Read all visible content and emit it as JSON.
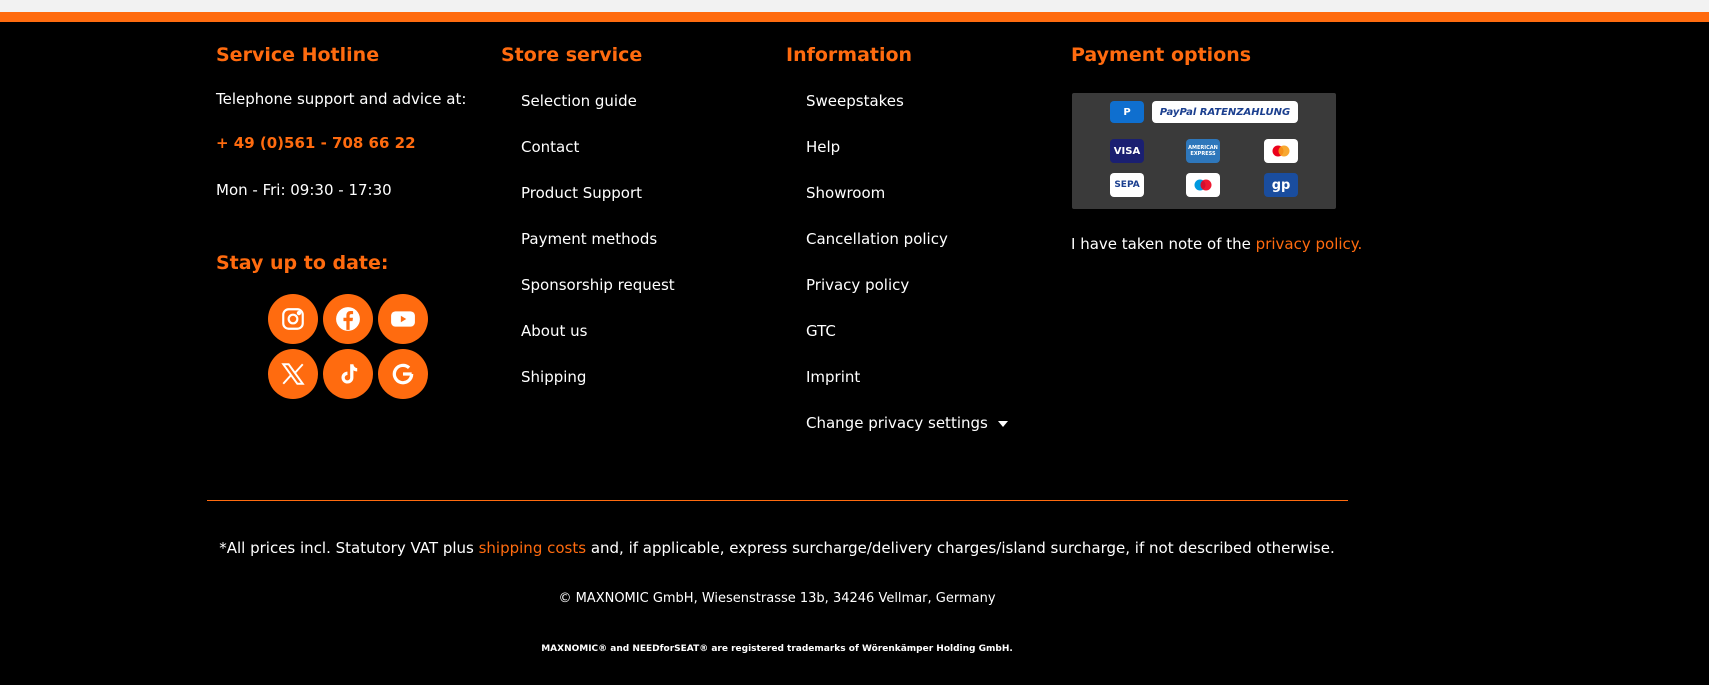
{
  "colors": {
    "accent": "#ff6b0f",
    "background": "#000000",
    "text": "#ffffff"
  },
  "hotline": {
    "title": "Service Hotline",
    "support_text": "Telephone support and advice at:",
    "phone": "+ 49 (0)561 - 708 66 22",
    "hours": "Mon - Fri: 09:30 - 17:30"
  },
  "stay": {
    "title": "Stay up to date:",
    "socials": [
      "instagram-icon",
      "facebook-icon",
      "youtube-icon",
      "x-icon",
      "tiktok-icon",
      "google-icon"
    ]
  },
  "store": {
    "title": "Store service",
    "links": [
      "Selection guide",
      "Contact",
      "Product Support",
      "Payment methods",
      "Sponsorship request",
      "About us",
      "Shipping"
    ]
  },
  "information": {
    "title": "Information",
    "links": [
      "Sweepstakes",
      "Help",
      "Showroom",
      "Cancellation policy",
      "Privacy policy",
      "GTC",
      "Imprint",
      "Change privacy settings"
    ]
  },
  "payment": {
    "title": "Payment options",
    "logos": [
      "P",
      "PayPal RATENZAHLUNG",
      "VISA",
      "AMERICAN EXPRESS",
      "mastercard",
      "SEPA",
      "maestro",
      "gp"
    ],
    "privacy_prefix": "I have taken note of the ",
    "privacy_link": "privacy policy."
  },
  "footer": {
    "vat_prefix": "*All prices incl. Statutory VAT plus ",
    "vat_link": "shipping costs",
    "vat_suffix": " and, if applicable, express surcharge/delivery charges/island surcharge, if not described otherwise.",
    "copyright": "© MAXNOMIC GmbH, Wiesenstrasse 13b, 34246 Vellmar, Germany",
    "trademark": "MAXNOMIC® and NEEDforSEAT® are registered trademarks of Wörenkämper Holding GmbH."
  }
}
